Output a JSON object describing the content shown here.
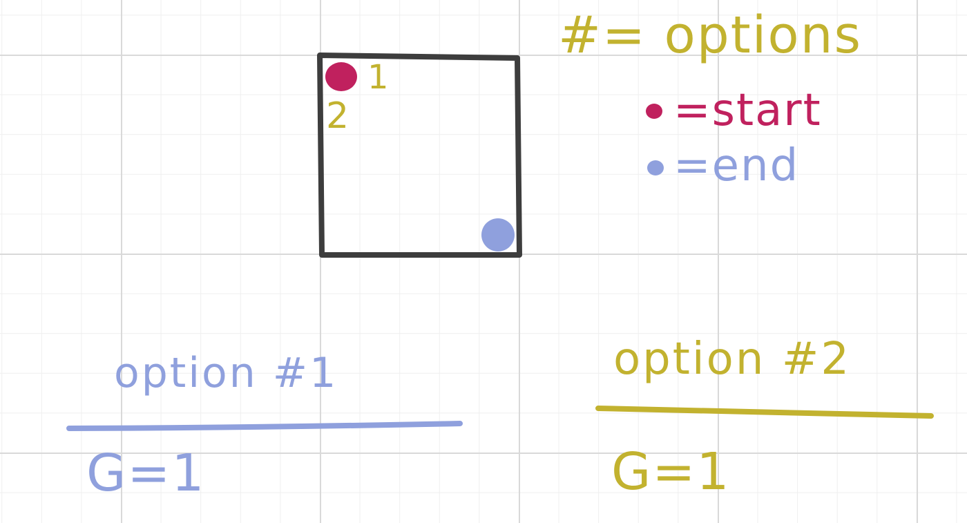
{
  "colors": {
    "ink_black": "#3d3d3d",
    "start_magenta": "#c0215e",
    "end_blue": "#8fa0dd",
    "gold": "#c2b22f"
  },
  "legend": {
    "options": "#= options",
    "start": "=start",
    "end": "=end"
  },
  "grid_box": {
    "num_1": "1",
    "num_2": "2"
  },
  "option1": {
    "title": "option #1",
    "value": "G=1"
  },
  "option2": {
    "title": "option #2",
    "value": "G=1"
  }
}
